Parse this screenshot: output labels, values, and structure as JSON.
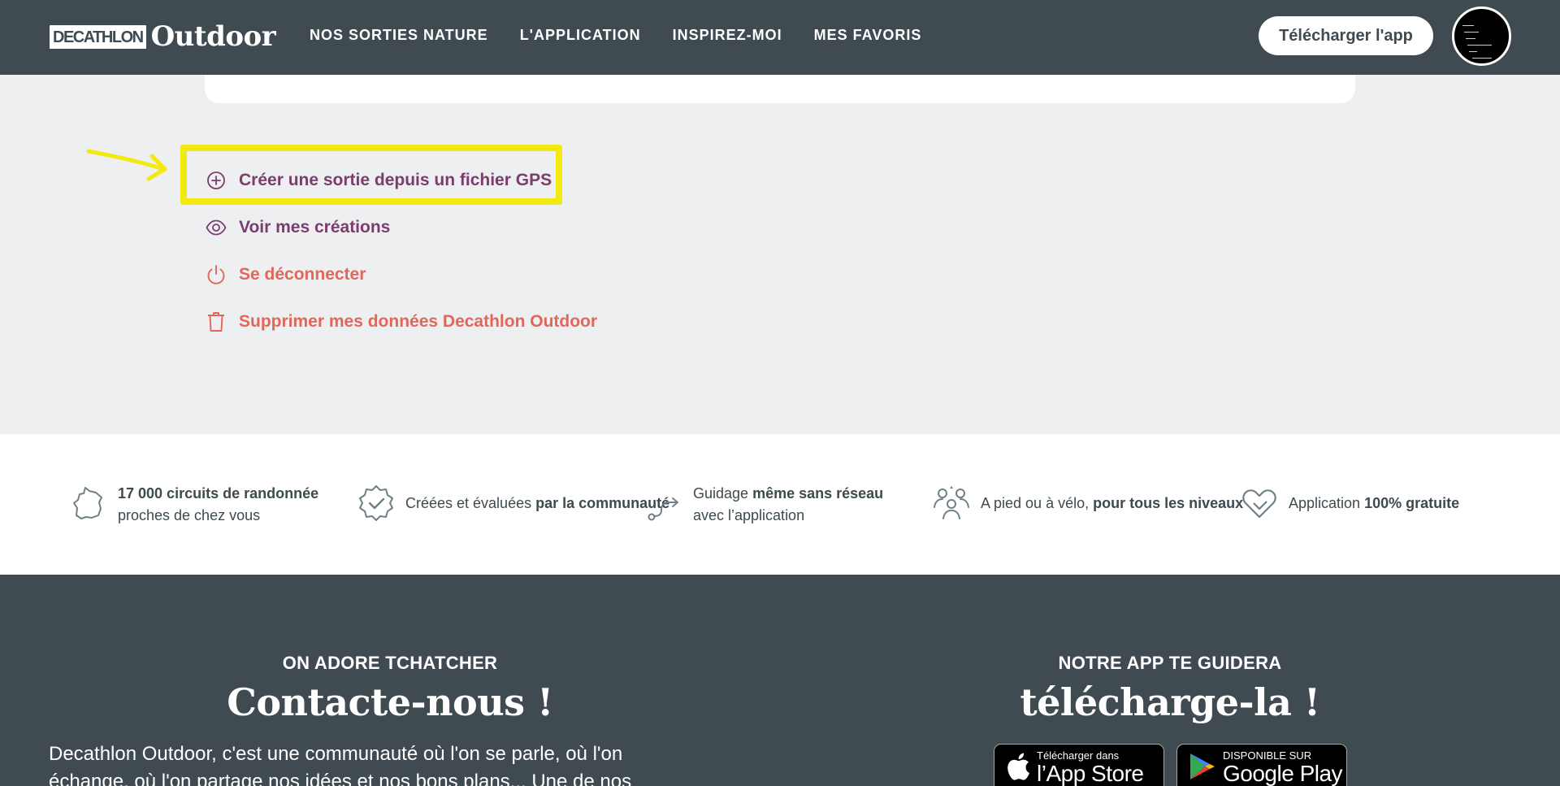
{
  "header": {
    "logo_box": "DECATHLON",
    "logo_word": "Outdoor",
    "nav": [
      "NOS SORTIES NATURE",
      "L'APPLICATION",
      "INSPIREZ-MOI",
      "MES FAVORIS"
    ],
    "download_button": "Télécharger l'app"
  },
  "actions": [
    {
      "label": "Créer une sortie depuis un fichier GPS",
      "icon": "plus-circle-icon",
      "color": "#7b3c6e"
    },
    {
      "label": "Voir mes créations",
      "icon": "eye-icon",
      "color": "#7b3c6e"
    },
    {
      "label": "Se déconnecter",
      "icon": "power-icon",
      "color": "#e2675a"
    },
    {
      "label": "Supprimer mes données Decathlon Outdoor",
      "icon": "trash-icon",
      "color": "#e2675a"
    }
  ],
  "annotation": {
    "highlight_color": "#f1e90f"
  },
  "features": [
    {
      "bold": "17 000 circuits de randonnée",
      "rest": "proches de chez vous",
      "icon": "france-map-icon"
    },
    {
      "pre": "Créées et évaluées ",
      "bold": "par la communauté",
      "icon": "verified-badge-icon"
    },
    {
      "pre": "Guidage ",
      "bold": "même sans réseau",
      "rest": "avec l’application",
      "icon": "route-icon"
    },
    {
      "pre": "A pied ou à vélo, ",
      "bold": "pour tous les niveaux",
      "icon": "community-icon"
    },
    {
      "pre": "Application ",
      "bold": "100% gratuite",
      "icon": "heart-icon"
    }
  ],
  "footer": {
    "left_kicker": "ON ADORE TCHATCHER",
    "left_title": "Contacte-nous !",
    "left_text": "Decathlon Outdoor, c'est une communauté où l'on se parle, où l'on échange, où l'on partage nos idées et nos bons plans... Une de nos",
    "right_kicker": "NOTRE APP TE GUIDERA",
    "right_title": "télécharge-la !",
    "app_store_small": "Télécharger dans",
    "app_store_big": "l’App Store",
    "google_small": "DISPONIBLE SUR",
    "google_big": "Google Play"
  },
  "colors": {
    "header_bg": "#3f4b50",
    "page_bg": "#eeeff0",
    "purple": "#7b3c6e",
    "red": "#e2675a"
  }
}
